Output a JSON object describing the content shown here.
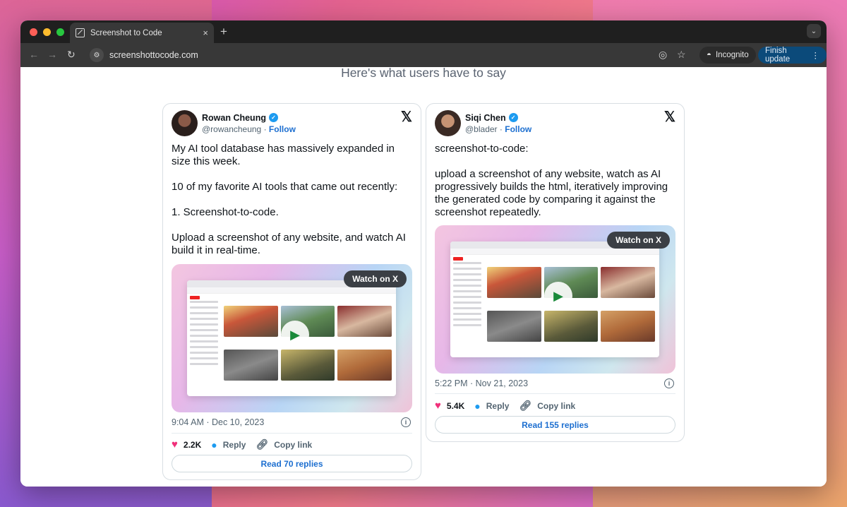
{
  "browser": {
    "tab_title": "Screenshot to Code",
    "tab_close": "×",
    "new_tab": "+",
    "url": "screenshottocode.com",
    "incognito_label": "Incognito",
    "finish_update_label": "Finish update",
    "traffic_lights": [
      "#ff5f57",
      "#febc2e",
      "#28c840"
    ]
  },
  "page": {
    "heading": "Here's what users have to say"
  },
  "tweets": [
    {
      "name": "Rowan Cheung",
      "handle": "@rowancheung",
      "follow": "Follow",
      "text": "My AI tool database has massively expanded in size this week.\n\n10 of my favorite AI tools that came out recently:\n\n1. Screenshot-to-code.\n\nUpload a screenshot of any website, and watch AI build it in real-time.",
      "watch_label": "Watch on X",
      "time": "9:04 AM · Dec 10, 2023",
      "likes": "2.2K",
      "reply_label": "Reply",
      "copy_link_label": "Copy link",
      "read_replies": "Read 70 replies"
    },
    {
      "name": "Siqi Chen",
      "handle": "@blader",
      "follow": "Follow",
      "text": "screenshot-to-code:\n\nupload a screenshot of any website, watch as AI progressively builds the html, iteratively improving the generated code by comparing it against the screenshot repeatedly.",
      "watch_label": "Watch on X",
      "time": "5:22 PM · Nov 21, 2023",
      "likes": "5.4K",
      "reply_label": "Reply",
      "copy_link_label": "Copy link",
      "read_replies": "Read 155 replies"
    }
  ],
  "colors": {
    "accent_blue": "#1d6fd0",
    "like_pink": "#f0307a",
    "verified_blue": "#1d9bf0"
  }
}
